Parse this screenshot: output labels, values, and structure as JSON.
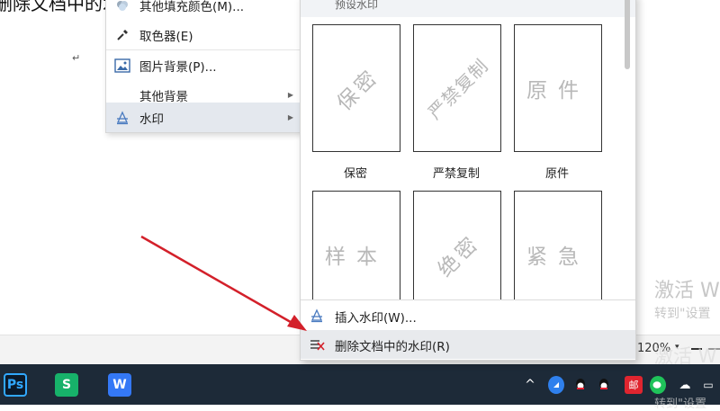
{
  "document": {
    "partial_text": "删除文档中的水",
    "paragraph_mark": "↵"
  },
  "context_menu": {
    "items": [
      {
        "label": "其他填充颜色(M)...",
        "icon": "color-swatch-icon"
      },
      {
        "label": "取色器(E)",
        "icon": "eyedropper-icon"
      },
      {
        "label": "图片背景(P)...",
        "icon": "image-icon"
      },
      {
        "label": "其他背景",
        "icon": "none",
        "has_submenu": true
      },
      {
        "label": "水印",
        "icon": "watermark-icon",
        "has_submenu": true,
        "active": true
      }
    ]
  },
  "watermark_submenu": {
    "section_title": "预设水印",
    "presets": [
      {
        "text": "保密",
        "label": "保密",
        "style": "diagonal"
      },
      {
        "text": "严禁复制",
        "label": "严禁复制",
        "style": "diagonal"
      },
      {
        "text": "原件",
        "label": "原件",
        "style": "horizontal"
      },
      {
        "text": "样本",
        "label": "",
        "style": "horizontal"
      },
      {
        "text": "绝密",
        "label": "",
        "style": "diagonal"
      },
      {
        "text": "紧急",
        "label": "",
        "style": "horizontal"
      }
    ],
    "insert_label": "插入水印(W)...",
    "delete_label": "删除文档中的水印(R)"
  },
  "statusbar": {
    "zoom": "120%",
    "zoom_caret": "▾",
    "zoom_minus": "—"
  },
  "overlay": {
    "activate_title": "激活 W",
    "activate_sub": "转到\"设置",
    "activate_title_2": "激活 W",
    "activate_sub_2": "转到\"设置"
  },
  "taskbar": {
    "apps": [
      {
        "name": "Ps",
        "icon": "photoshop-icon"
      },
      {
        "name": "S",
        "icon": "wps-spreadsheet-icon"
      },
      {
        "name": "W",
        "icon": "wps-writer-icon"
      }
    ],
    "tray": {
      "chevron": "^",
      "mail": "邮",
      "cloud": "☁",
      "battery": "▭"
    }
  },
  "colors": {
    "arrow": "#d3202a",
    "taskbar_bg": "#1d2a38",
    "menu_highlight": "#e4e8ee"
  }
}
